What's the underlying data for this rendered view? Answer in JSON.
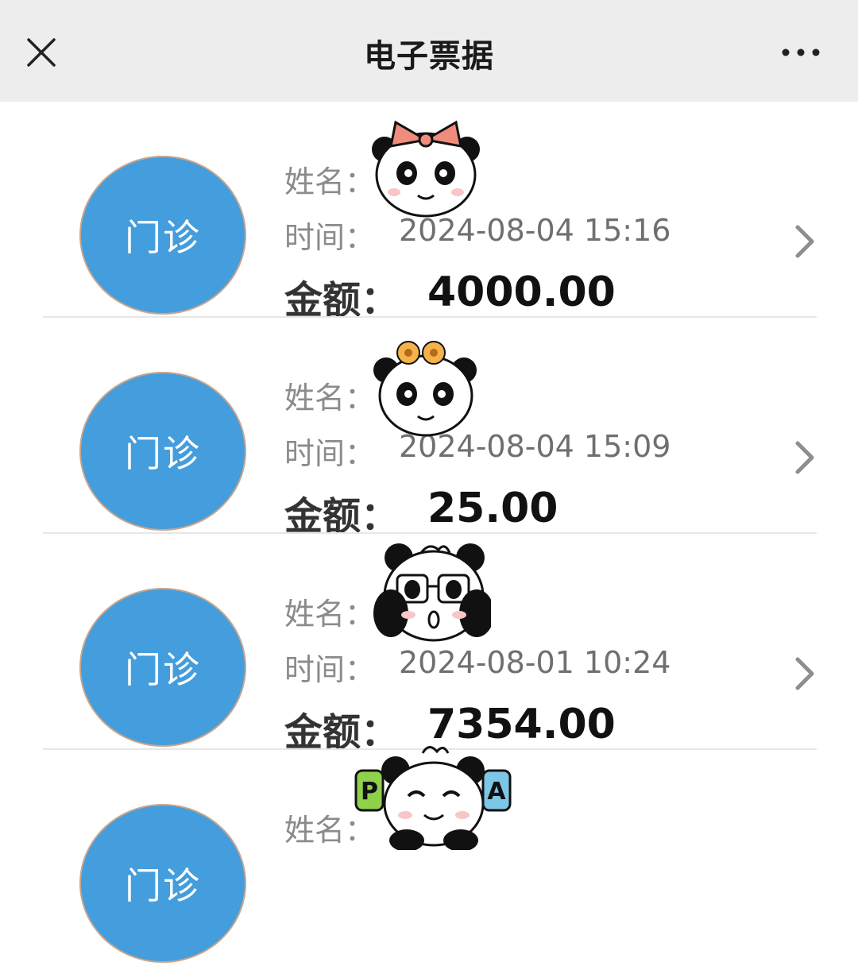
{
  "header": {
    "title": "电子票据",
    "close_icon": "close-icon",
    "more_icon": "more-icon"
  },
  "records": [
    {
      "type": "门诊",
      "name_label": "姓名：",
      "time_label": "时间：",
      "time": "2024-08-04 15:16",
      "amount_label": "金额：",
      "amount": "4000.00",
      "sticker": "panda-bow-sticker"
    },
    {
      "type": "门诊",
      "name_label": "姓名：",
      "time_label": "时间：",
      "time": "2024-08-04 15:09",
      "amount_label": "金额：",
      "amount": "25.00",
      "sticker": "panda-flower-sticker"
    },
    {
      "type": "门诊",
      "name_label": "姓名：",
      "time_label": "时间：",
      "time": "2024-08-01 10:24",
      "amount_label": "金额：",
      "amount": "7354.00",
      "sticker": "panda-glasses-sticker"
    },
    {
      "type": "门诊",
      "name_label": "姓名：",
      "sticker": "panda-pa-sticker"
    }
  ],
  "colors": {
    "nav_bg": "#ededed",
    "badge_blue": "#449ddc",
    "label_gray": "#8b8b8b",
    "amount_black": "#111111"
  }
}
